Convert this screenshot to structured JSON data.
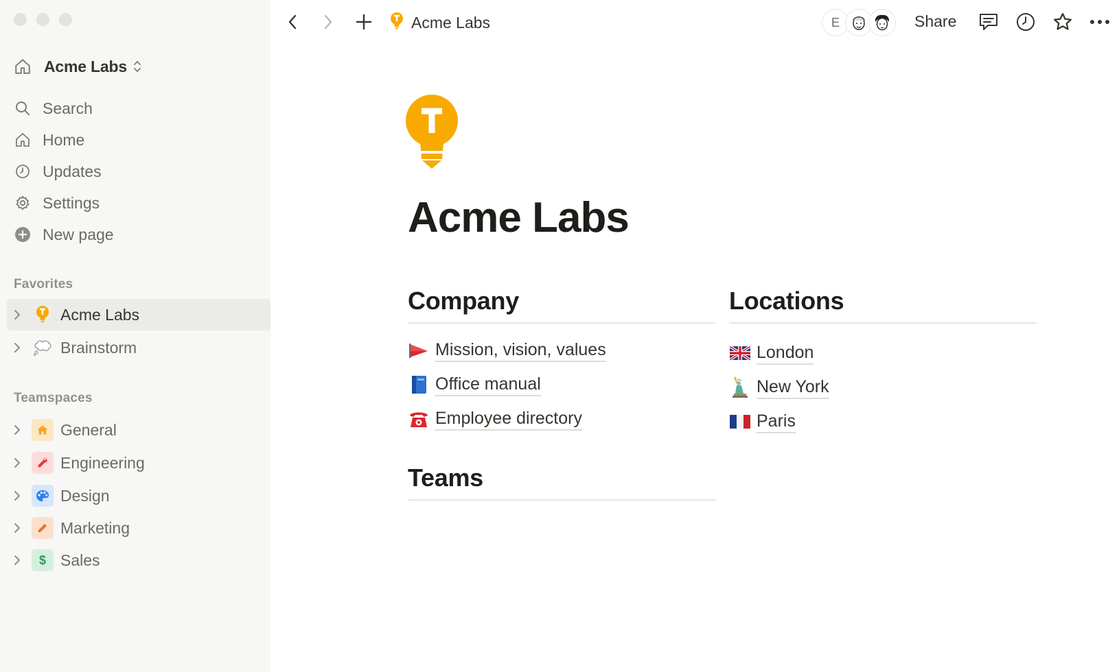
{
  "workspace": {
    "name": "Acme Labs"
  },
  "sidebar": {
    "nav": [
      {
        "label": "Search",
        "icon": "search-icon"
      },
      {
        "label": "Home",
        "icon": "home-icon"
      },
      {
        "label": "Updates",
        "icon": "clock-icon"
      },
      {
        "label": "Settings",
        "icon": "gear-icon"
      },
      {
        "label": "New page",
        "icon": "plus-circle-icon"
      }
    ],
    "favorites_label": "Favorites",
    "favorites": [
      {
        "label": "Acme Labs",
        "icon": "lightbulb-icon",
        "selected": true
      },
      {
        "label": "Brainstorm",
        "icon": "thought-bubble-icon",
        "selected": false
      }
    ],
    "teamspaces_label": "Teamspaces",
    "teamspaces": [
      {
        "label": "General",
        "icon": "house-icon",
        "color": "#f5a623"
      },
      {
        "label": "Engineering",
        "icon": "wrench-icon",
        "color": "#e03e3e"
      },
      {
        "label": "Design",
        "icon": "palette-icon",
        "color": "#2f80ed"
      },
      {
        "label": "Marketing",
        "icon": "pencil-icon",
        "color": "#e8742a"
      },
      {
        "label": "Sales",
        "icon": "dollar-icon",
        "color": "#2e9b5e"
      }
    ]
  },
  "topbar": {
    "breadcrumb": "Acme Labs",
    "avatar_letter": "E",
    "share_label": "Share"
  },
  "page": {
    "icon": "lightbulb-t-icon",
    "title": "Acme Labs",
    "accent": "#f8aa00",
    "company": {
      "heading": "Company",
      "links": [
        {
          "emoji": "🚩",
          "label": "Mission, vision, values"
        },
        {
          "emoji": "📘",
          "label": "Office manual"
        },
        {
          "emoji": "☎️",
          "label": "Employee directory"
        }
      ]
    },
    "locations": {
      "heading": "Locations",
      "links": [
        {
          "emoji": "🇬🇧",
          "label": "London"
        },
        {
          "emoji": "🗽",
          "label": "New York"
        },
        {
          "emoji": "🇫🇷",
          "label": "Paris"
        }
      ]
    },
    "teams": {
      "heading": "Teams"
    }
  }
}
